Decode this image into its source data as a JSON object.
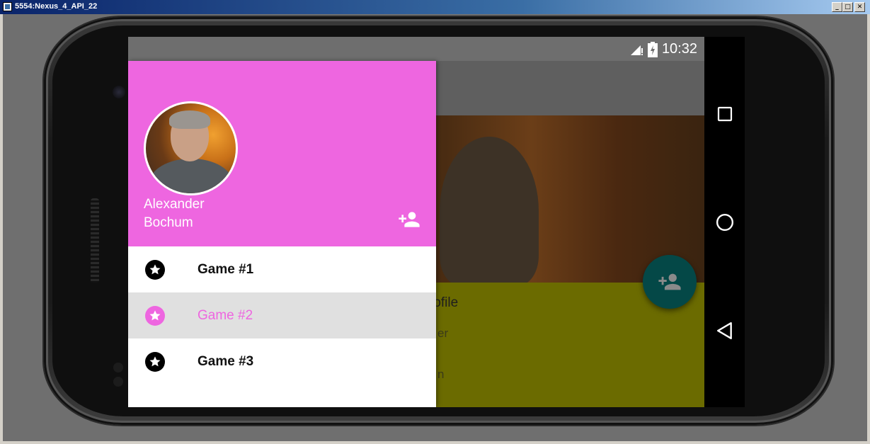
{
  "window": {
    "title": "5554:Nexus_4_API_22",
    "min_label": "_",
    "max_label": "□",
    "close_label": "✕"
  },
  "status_bar": {
    "time": "10:32"
  },
  "drawer": {
    "user_name_line1": "Alexander",
    "user_name_line2": "Bochum",
    "header_color": "#ee66e0",
    "items": [
      {
        "label": "Game #1",
        "selected": false
      },
      {
        "label": "Game #2",
        "selected": true
      },
      {
        "label": "Game #3",
        "selected": false
      }
    ]
  },
  "background_app": {
    "card_title": "rofile",
    "card_line1": "er",
    "card_line2": "n",
    "fab_color": "#044847"
  },
  "colors": {
    "accent": "#ee66e0",
    "card": "#6b6b00"
  }
}
